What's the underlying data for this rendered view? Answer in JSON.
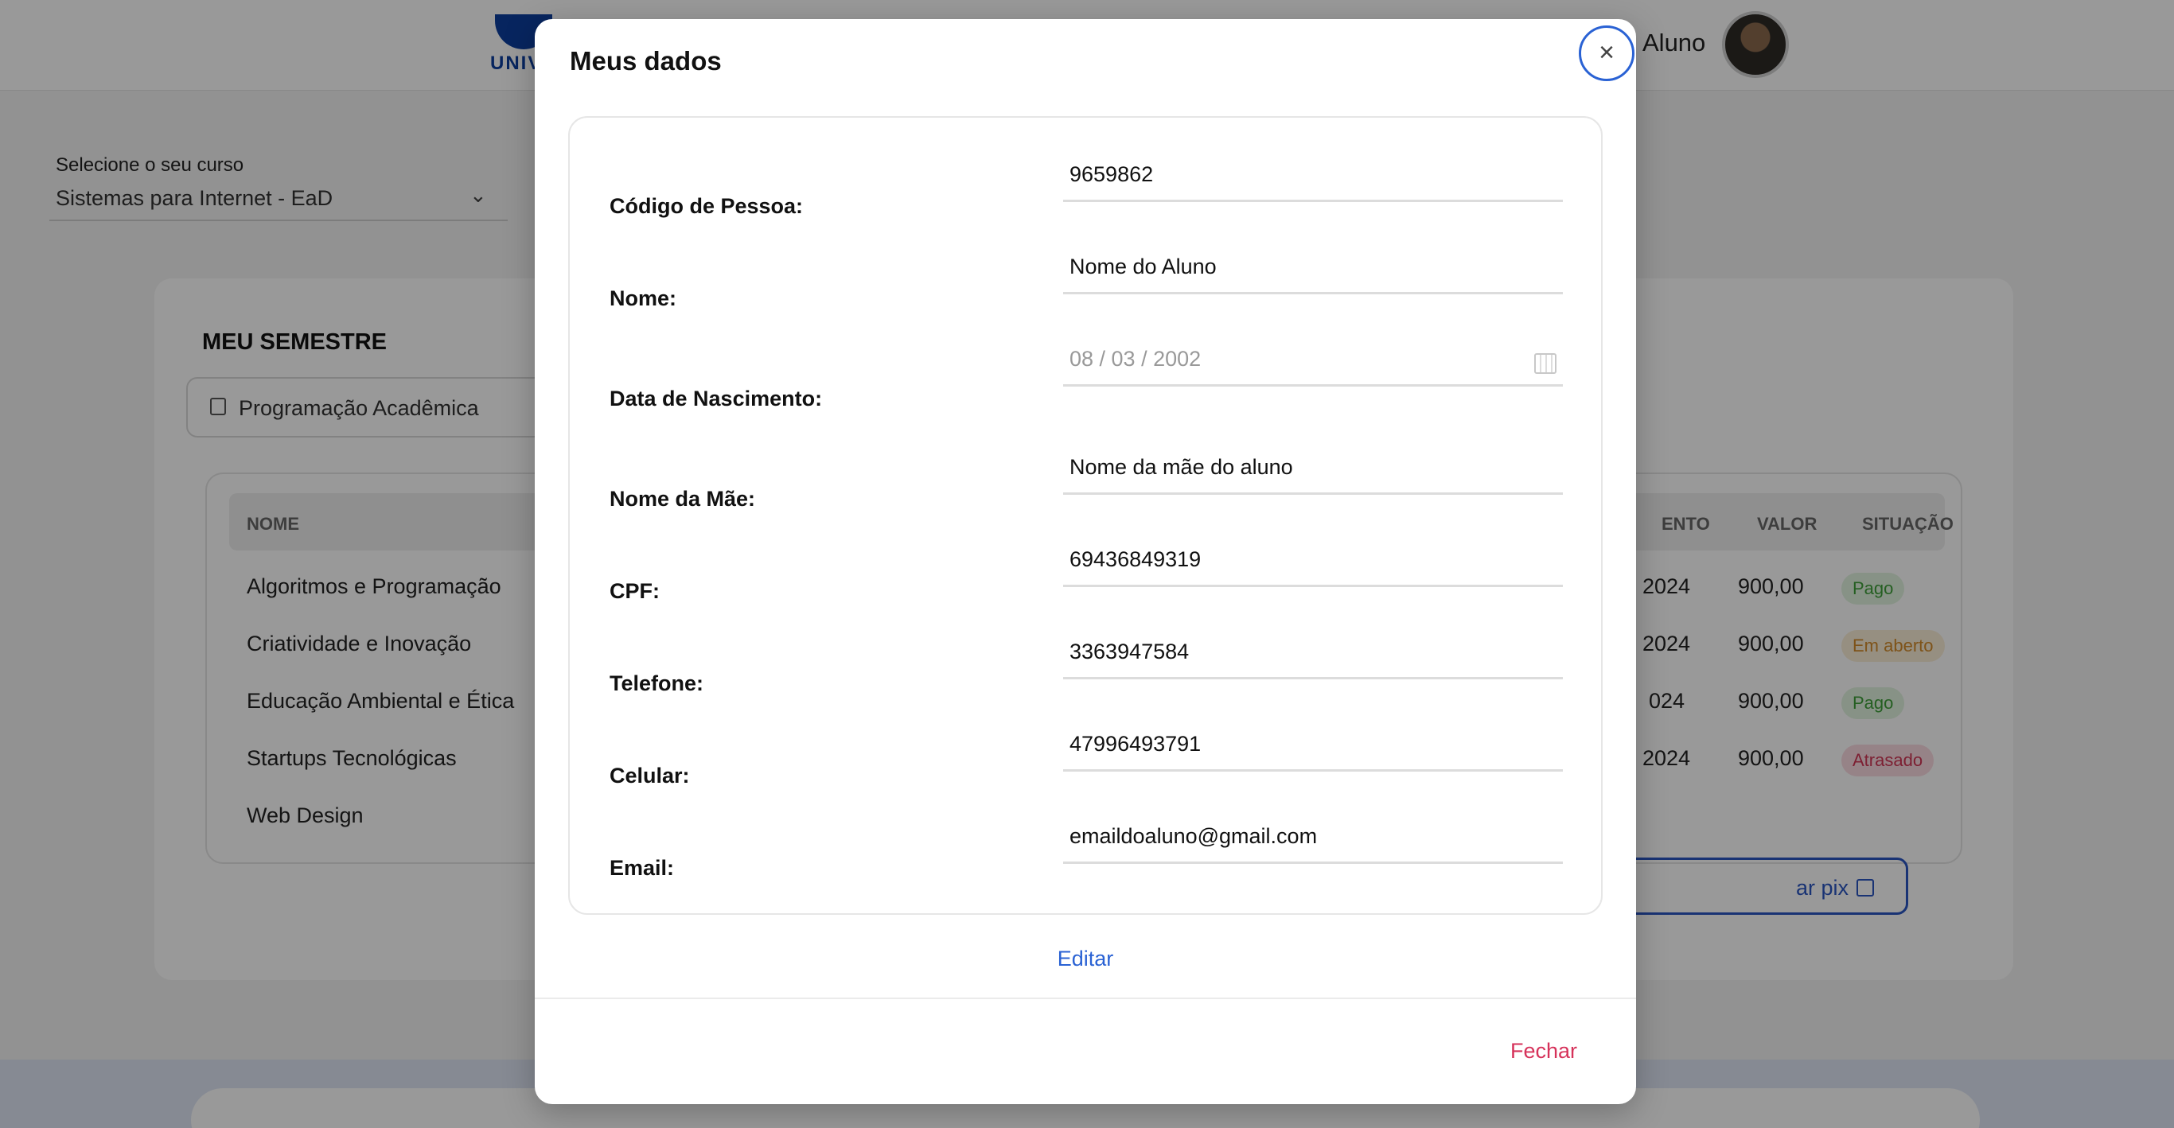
{
  "header": {
    "logo_text": "UNIV",
    "user_name": "Aluno"
  },
  "course": {
    "label": "Selecione o seu curso",
    "value": "Sistemas para Internet - EaD"
  },
  "semester": {
    "title": "MEU SEMESTRE",
    "tab": "Programação Acadêmica",
    "columns": {
      "name": "NOME",
      "due": "ENTO",
      "value": "VALOR",
      "status": "SITUAÇÃO"
    },
    "rows": [
      {
        "name": "Algoritmos e Programação",
        "due": "2024",
        "value": "900,00",
        "status": "Pago"
      },
      {
        "name": "Criatividade e Inovação",
        "due": "2024",
        "value": "900,00",
        "status": "Em aberto"
      },
      {
        "name": "Educação Ambiental e Ética",
        "due": "024",
        "value": "900,00",
        "status": "Pago"
      },
      {
        "name": "Startups Tecnológicas",
        "due": "2024",
        "value": "900,00",
        "status": "Atrasado"
      },
      {
        "name": "Web Design"
      }
    ],
    "pix_button": "ar pix"
  },
  "modal": {
    "title": "Meus dados",
    "close_icon": "close-icon",
    "fields": [
      {
        "label": "Código de Pessoa:",
        "value": "9659862"
      },
      {
        "label": "Nome:",
        "value": "Nome do Aluno"
      },
      {
        "label": "Data de Nascimento:",
        "value": "08 / 03 / 2002"
      },
      {
        "label": "Nome da Mãe:",
        "value": "Nome da mãe do aluno"
      },
      {
        "label": "CPF:",
        "value": "69436849319"
      },
      {
        "label": "Telefone:",
        "value": "3363947584"
      },
      {
        "label": "Celular:",
        "value": "47996493791"
      },
      {
        "label": "Email:",
        "value": "emaildoaluno@gmail.com"
      }
    ],
    "edit_label": "Editar",
    "close_label": "Fechar"
  },
  "colors": {
    "accent": "#2a62d4",
    "danger": "#d6325a",
    "pago": "#3e9e3a",
    "aberto": "#d28a2a",
    "atrasado": "#d13655"
  }
}
